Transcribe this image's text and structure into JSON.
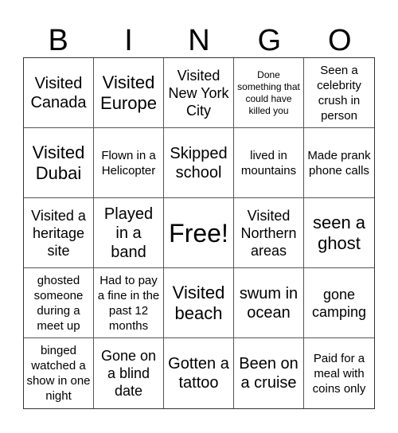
{
  "header": {
    "letters": [
      "B",
      "I",
      "N",
      "G",
      "O"
    ]
  },
  "cells": [
    [
      "Visited Canada",
      "Visited Europe",
      "Visited New York City",
      "Done something that could have killed you",
      "Seen a celebrity crush in person"
    ],
    [
      "Visited Dubai",
      "Flown in a Helicopter",
      "Skipped school",
      "lived in mountains",
      "Made prank phone calls"
    ],
    [
      "Visited a heritage site",
      "Played in a band",
      "Free!",
      "Visited Northern areas",
      "seen a ghost"
    ],
    [
      "ghosted someone during a meet up",
      "Had to pay a fine in the past 12 months",
      "Visited beach",
      "swum in ocean",
      "gone camping"
    ],
    [
      "binged watched a show in one night",
      "Gone on a blind date",
      "Gotten a tattoo",
      "Been on a cruise",
      "Paid for a meal with coins only"
    ]
  ],
  "free_cell": {
    "row": 2,
    "col": 2,
    "label": "Free!"
  }
}
